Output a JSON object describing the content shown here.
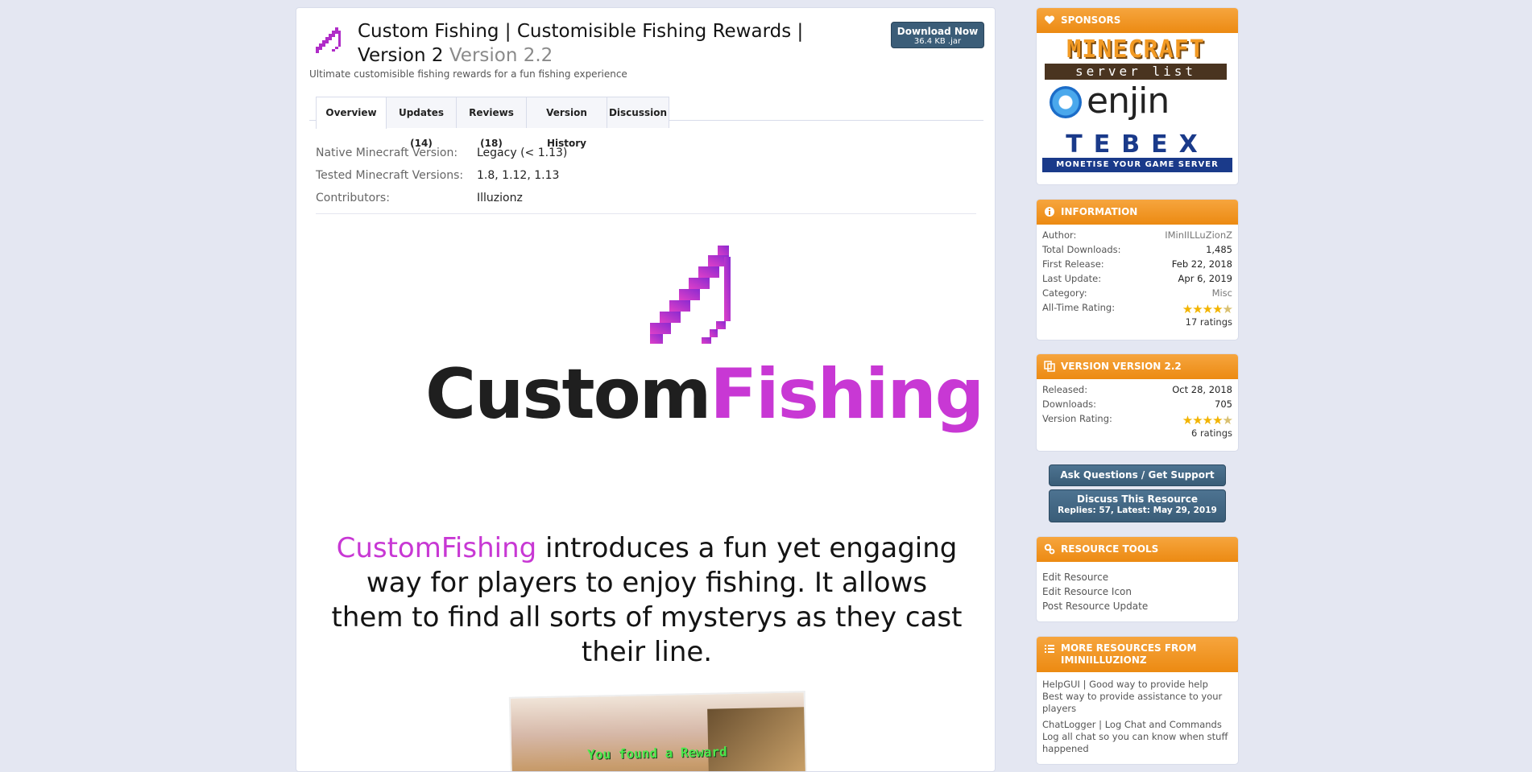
{
  "resource": {
    "title": "Custom Fishing | Customisible Fishing Rewards | Version 2",
    "version": "Version 2.2",
    "tagline": "Ultimate customisible fishing rewards for a fun fishing experience",
    "icon": "fishing-rod-icon",
    "download": {
      "label": "Download Now",
      "size": "36.4 KB .jar"
    }
  },
  "tabs": [
    {
      "label": "Overview",
      "active": true
    },
    {
      "label": "Updates (14)"
    },
    {
      "label": "Reviews (18)"
    },
    {
      "label": "Version History"
    },
    {
      "label": "Discussion"
    }
  ],
  "specs": [
    {
      "key": "Native Minecraft Version:",
      "value": "Legacy (< 1.13)"
    },
    {
      "key": "Tested Minecraft Versions:",
      "value": "1.8, 1.12, 1.13"
    },
    {
      "key": "Contributors:",
      "value": "Illuzionz"
    }
  ],
  "description": {
    "logo_word1": "Custom",
    "logo_word2": "Fishing",
    "intro_highlight": "CustomFishing",
    "intro_rest": " introduces a fun yet engaging way for players to enjoy fishing. It allows them to find all sorts of mysterys as they cast their line.",
    "preview_text": "You found a Reward"
  },
  "colors": {
    "accent": "#c838d4",
    "panel_header": "#ec8a12",
    "button_blue": "#3b5d78",
    "star": "#f2b400"
  },
  "sidebar": {
    "sponsors": {
      "title": "Sponsors",
      "icon": "heart-icon",
      "logos": {
        "mc_line1": "MINECRAFT",
        "mc_line2": "server list",
        "enjin": "enjin",
        "tebex": "TEBEX",
        "tebex_sub": "MONETISE YOUR GAME SERVER"
      }
    },
    "information": {
      "title": "Information",
      "icon": "info-icon",
      "author_label": "Author:",
      "author": "IMinIILLuZionZ",
      "downloads_label": "Total Downloads:",
      "downloads": "1,485",
      "first_release_label": "First Release:",
      "first_release": "Feb 22, 2018",
      "last_update_label": "Last Update:",
      "last_update": "Apr 6, 2019",
      "category_label": "Category:",
      "category": "Misc",
      "rating_label": "All-Time Rating:",
      "rating_stars": 4.5,
      "rating_count": "17 ratings"
    },
    "version": {
      "title": "Version Version 2.2",
      "icon": "copy-icon",
      "released_label": "Released:",
      "released": "Oct 28, 2018",
      "downloads_label": "Downloads:",
      "downloads": "705",
      "rating_label": "Version Rating:",
      "rating_stars": 4.5,
      "rating_count": "6 ratings"
    },
    "ask_button": "Ask Questions / Get Support",
    "discuss_button": {
      "label": "Discuss This Resource",
      "sub": "Replies: 57, Latest: May 29, 2019"
    },
    "tools": {
      "title": "Resource Tools",
      "icon": "gears-icon",
      "links": [
        "Edit Resource",
        "Edit Resource Icon",
        "Post Resource Update"
      ]
    },
    "more": {
      "title": "More Resources from IMinIILLuZionZ",
      "icon": "list-icon",
      "items": [
        {
          "title": "HelpGUI | Good way to provide help",
          "desc": "Best way to provide assistance to your players"
        },
        {
          "title": "ChatLogger | Log Chat and Commands",
          "desc": "Log all chat so you can know when stuff happened"
        }
      ]
    }
  }
}
